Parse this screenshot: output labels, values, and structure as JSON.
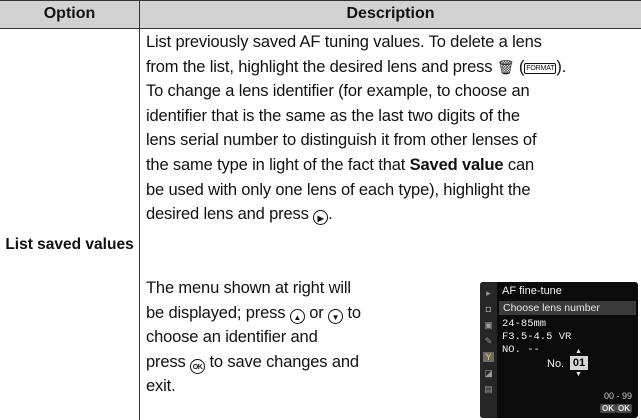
{
  "table": {
    "header_option": "Option",
    "header_description": "Description",
    "row_option": "List saved values",
    "desc1": {
      "l1": "List previously saved AF tuning values.  To delete a lens",
      "l2a": "from the list, highlight the desired lens and press ",
      "l2b": ").",
      "trash_glyph": "🗑",
      "format_label": "FORMAT",
      "l3": "To change a lens identifier (for example, to choose an",
      "l4": "identifier that is the same as the last two digits of the",
      "l5": "lens serial number to distinguish it from other lenses of",
      "l6a": "the same type in light of the fact that ",
      "l6b": "Saved value",
      "l6c": " can",
      "l7": "be used with only one lens of each type), highlight the",
      "l8a": "desired lens and press ",
      "l8b": "."
    },
    "desc2": {
      "l1": "The menu shown at right will",
      "l2a": "be displayed; press ",
      "l2b": " or ",
      "l2c": " to",
      "l3": "choose an identifier and",
      "l4a": "press ",
      "l4b": " to save changes and",
      "l5": "exit."
    },
    "glyphs": {
      "right": "▶",
      "up": "▲",
      "down": "▼",
      "ok": "OK"
    }
  },
  "camera_screen": {
    "title": "AF fine-tune",
    "subtitle": "Choose lens number",
    "lens_line1": "24-85mm",
    "lens_line2": "F3.5-4.5 VR",
    "lens_line3": "NO. --",
    "no_label": "No.",
    "number_value": "01",
    "range": "00 - 99",
    "ok_badge": "OK",
    "ok_label": "OK",
    "sidebar_icons": [
      "play-icon",
      "camera-icon",
      "movie-icon",
      "pencil-icon",
      "wrench-icon",
      "retouch-icon",
      "list-icon"
    ]
  }
}
